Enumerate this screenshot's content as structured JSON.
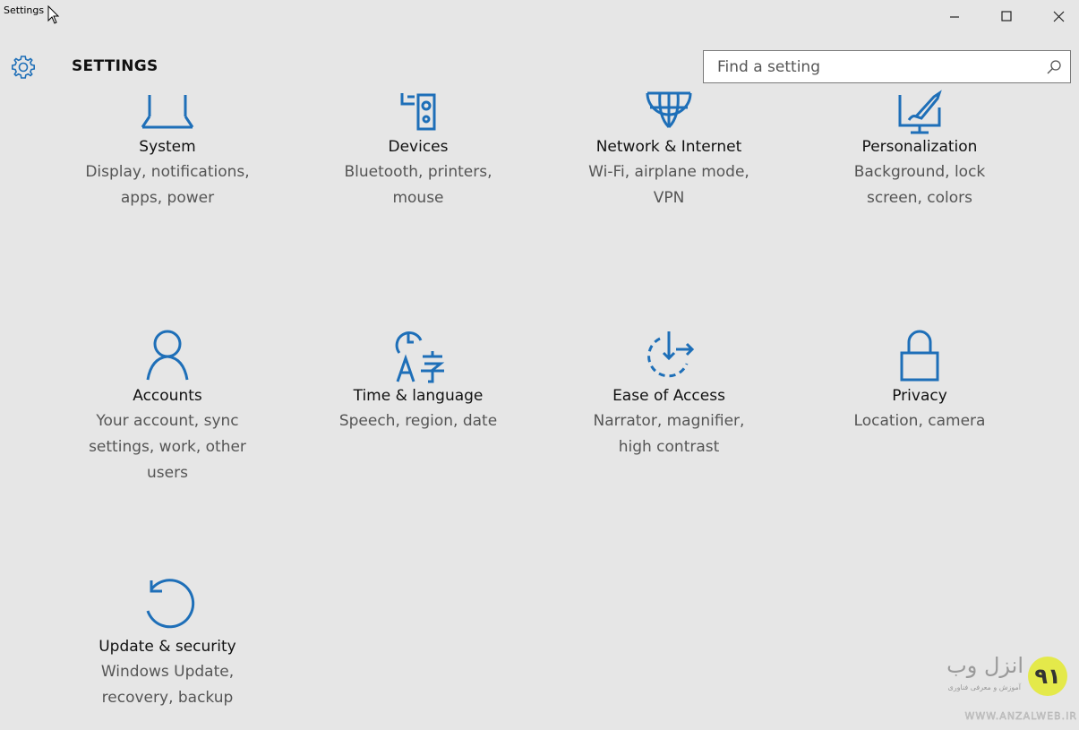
{
  "window": {
    "title": "Settings",
    "minimize_label": "–",
    "maximize_label": "☐",
    "close_label": "✕"
  },
  "header": {
    "title": "SETTINGS",
    "icon": "gear-icon"
  },
  "search": {
    "placeholder": "Find a setting",
    "value": "",
    "icon": "search-icon"
  },
  "categories": [
    {
      "name": "System",
      "description": "Display, notifications,\napps, power",
      "icon": "laptop-icon"
    },
    {
      "name": "Devices",
      "description": "Bluetooth, printers,\nmouse",
      "icon": "devices-icon"
    },
    {
      "name": "Network & Internet",
      "description": "Wi-Fi, airplane mode,\nVPN",
      "icon": "globe-icon"
    },
    {
      "name": "Personalization",
      "description": "Background, lock\nscreen, colors",
      "icon": "paint-monitor-icon"
    },
    {
      "name": "Accounts",
      "description": "Your account, sync\nsettings, work, other\nusers",
      "icon": "person-icon"
    },
    {
      "name": "Time & language",
      "description": "Speech, region, date",
      "icon": "time-language-icon"
    },
    {
      "name": "Ease of Access",
      "description": "Narrator, magnifier,\nhigh contrast",
      "icon": "ease-of-access-icon"
    },
    {
      "name": "Privacy",
      "description": "Location, camera",
      "icon": "lock-icon"
    },
    {
      "name": "Update & security",
      "description": "Windows Update,\nrecovery, backup",
      "icon": "update-icon"
    }
  ],
  "watermark": {
    "brand": "انزل وب",
    "tagline": "آموزش و معرفی فناوری",
    "url": "WWW.ANZALWEB.IR",
    "logo_text": "٩١"
  },
  "colors": {
    "accent": "#1e6fb8",
    "background": "#e6e6e6",
    "watermark_badge": "#e4e94a"
  }
}
